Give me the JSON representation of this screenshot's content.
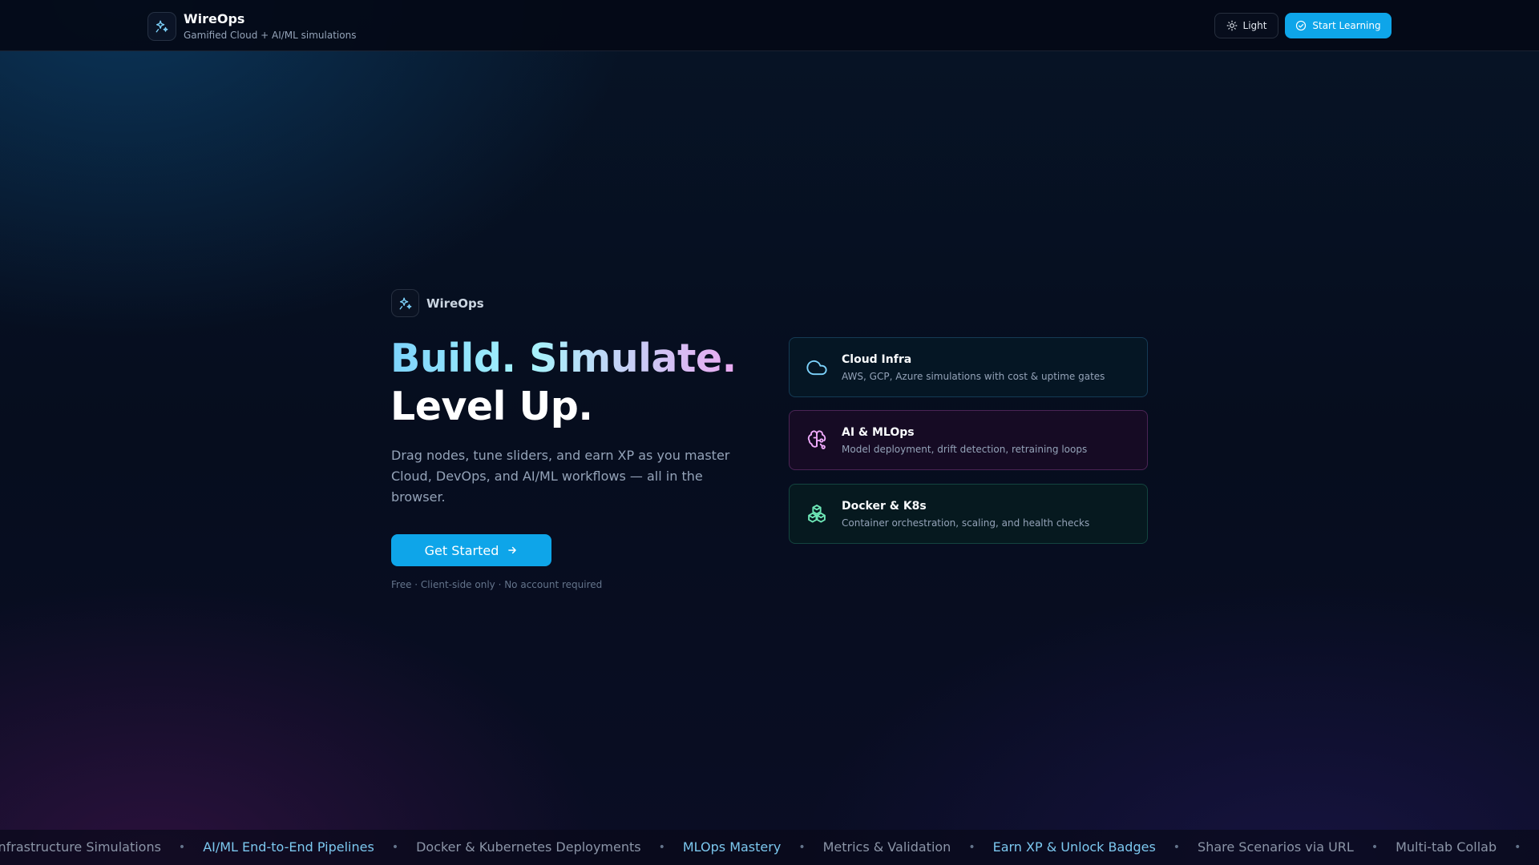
{
  "header": {
    "title": "WireOps",
    "subtitle": "Gamified Cloud + AI/ML simulations",
    "theme_label": "Light",
    "start_label": "Start Learning"
  },
  "hero": {
    "logo_name": "WireOps",
    "headline_1": "Build. Simulate.",
    "headline_2": "Level Up.",
    "lede": "Drag nodes, tune sliders, and earn XP as you master Cloud, DevOps, and AI/ML workflows — all in the browser.",
    "cta_label": "Get Started",
    "fineprint": "Free · Client-side only · No account required"
  },
  "features": [
    {
      "title": "Cloud Infra",
      "desc": "AWS, GCP, Azure simulations with cost & uptime gates",
      "icon": "cloud-icon",
      "color": "#7dd3fc"
    },
    {
      "title": "AI & MLOps",
      "desc": "Model deployment, drift detection, retraining loops",
      "icon": "brain-icon",
      "color": "#f0abfc"
    },
    {
      "title": "Docker & K8s",
      "desc": "Container orchestration, scaling, and health checks",
      "icon": "boxes-icon",
      "color": "#6ee7b7"
    }
  ],
  "marquee": [
    {
      "text": "Cloud Infrastructure Simulations",
      "style": "dim"
    },
    {
      "text": "AI/ML End-to-End Pipelines",
      "style": "hl"
    },
    {
      "text": "Docker & Kubernetes Deployments",
      "style": "dim"
    },
    {
      "text": "MLOps Mastery",
      "style": "hl"
    },
    {
      "text": "Metrics & Validation",
      "style": "dim"
    },
    {
      "text": "Earn XP & Unlock Badges",
      "style": "hl"
    },
    {
      "text": "Share Scenarios via URL",
      "style": "dim"
    },
    {
      "text": "Multi-tab Collab",
      "style": "dim"
    }
  ],
  "colors": {
    "accent": "#0ea5e9",
    "background": "#050b1a"
  }
}
